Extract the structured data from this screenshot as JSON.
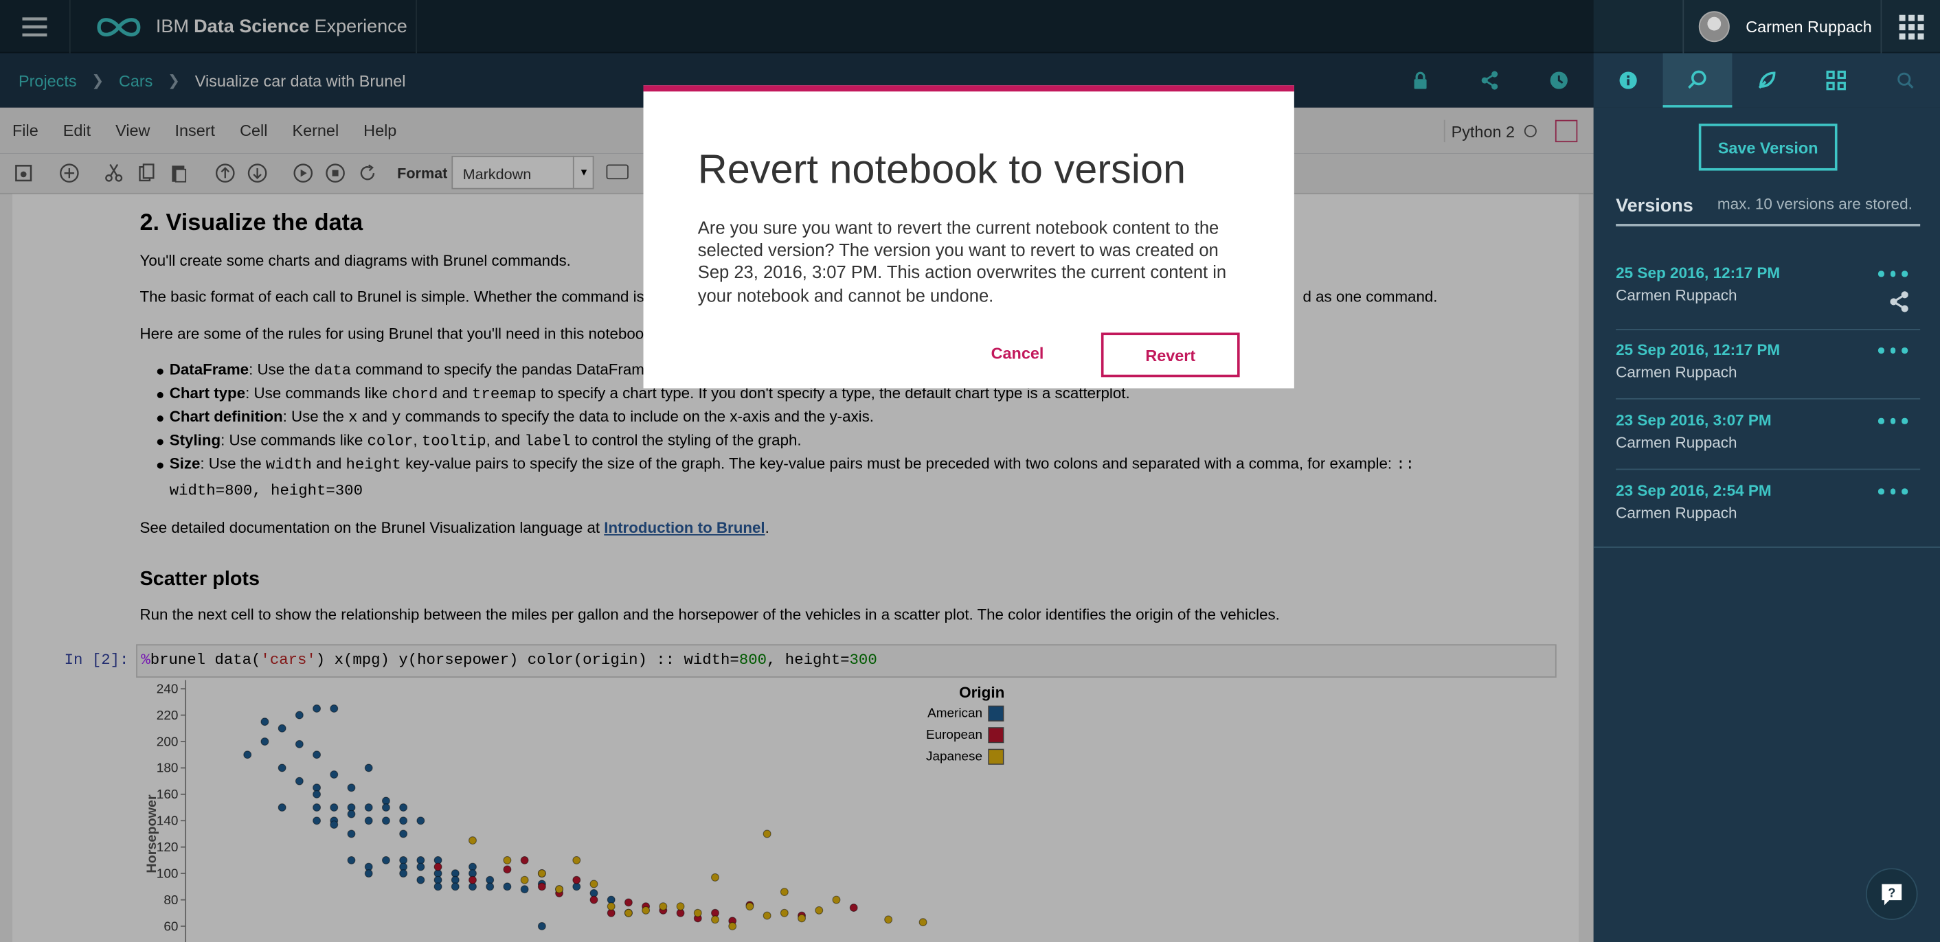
{
  "header": {
    "brand_prefix": "IBM",
    "brand_bold": "Data Science",
    "brand_suffix": "Experience",
    "user_name": "Carmen Ruppach"
  },
  "breadcrumb": [
    "Projects",
    "Cars",
    "Visualize car data with Brunel"
  ],
  "menu": [
    "File",
    "Edit",
    "View",
    "Insert",
    "Cell",
    "Kernel",
    "Help"
  ],
  "kernel": "Python 2",
  "toolbar": {
    "format_label": "Format",
    "format_value": "Markdown"
  },
  "notebook": {
    "h2": "2. Visualize the data",
    "p1": "You'll create some charts and diagrams with Brunel commands.",
    "p2a": "The basic format of each call to Brunel is simple. Whether the command is",
    "p2b": "d as one command.",
    "p3": "Here are some of the rules for using Brunel that you'll need in this noteboo",
    "bullets": [
      {
        "term": "DataFrame",
        "t1": ": Use the ",
        "c1": "data",
        "t2": " command to specify the pandas DataFram"
      },
      {
        "term": "Chart type",
        "t1": ": Use commands like ",
        "c1": "chord",
        "t2": " and ",
        "c2": "treemap",
        "t3": " to specify a chart type. If you don't specify a type, the default chart type is a scatterplot."
      },
      {
        "term": "Chart definition",
        "t1": ": Use the ",
        "c1": "x",
        "t2": " and ",
        "c2": "y",
        "t3": " commands to specify the data to include on the x-axis and the y-axis."
      },
      {
        "term": "Styling",
        "t1": ": Use commands like ",
        "c1": "color",
        "t2": ", ",
        "c2": "tooltip",
        "t3": ", and ",
        "c3": "label",
        "t4": " to control the styling of the graph."
      },
      {
        "term": "Size",
        "t1": ": Use the ",
        "c1": "width",
        "t2": " and ",
        "c2": "height",
        "t3": " key-value pairs to specify the size of the graph. The key-value pairs must be preceded with two colons and separated with a comma, for example: ",
        "c3": "::",
        "line2": "width=800, height=300"
      }
    ],
    "p4a": "See detailed documentation on the Brunel Visualization language at ",
    "p4link": "Introduction to Brunel",
    "p4b": ".",
    "h3": "Scatter plots",
    "p5": "Run the next cell to show the relationship between the miles per gallon and the horsepower of the vehicles in a scatter plot. The color identifies the origin of the vehicles.",
    "prompt": "In [2]:",
    "code": {
      "pct": "%",
      "a": "brunel data(",
      "s": "'cars'",
      "b": ") x(mpg) y(horsepower) color(origin) :: width=",
      "n1": "800",
      "c": ", height=",
      "n2": "300"
    }
  },
  "chart_data": {
    "type": "scatter",
    "ylabel": "Horsepower",
    "yticks": [
      60,
      80,
      100,
      120,
      140,
      160,
      180,
      200,
      220,
      240
    ],
    "legend_title": "Origin",
    "legend_position": "top-right",
    "series": [
      {
        "name": "American",
        "color": "#1f5f95",
        "points": [
          [
            9,
            190
          ],
          [
            10,
            215
          ],
          [
            10,
            200
          ],
          [
            11,
            210
          ],
          [
            11,
            180
          ],
          [
            11,
            150
          ],
          [
            12,
            220
          ],
          [
            12,
            198
          ],
          [
            12,
            170
          ],
          [
            13,
            225
          ],
          [
            13,
            190
          ],
          [
            13,
            165
          ],
          [
            13,
            160
          ],
          [
            13,
            150
          ],
          [
            13,
            140
          ],
          [
            14,
            225
          ],
          [
            14,
            175
          ],
          [
            14,
            150
          ],
          [
            14,
            140
          ],
          [
            14,
            137
          ],
          [
            15,
            165
          ],
          [
            15,
            150
          ],
          [
            15,
            145
          ],
          [
            15,
            130
          ],
          [
            15,
            110
          ],
          [
            16,
            180
          ],
          [
            16,
            150
          ],
          [
            16,
            140
          ],
          [
            16,
            105
          ],
          [
            16,
            100
          ],
          [
            17,
            155
          ],
          [
            17,
            150
          ],
          [
            17,
            140
          ],
          [
            17,
            110
          ],
          [
            18,
            150
          ],
          [
            18,
            140
          ],
          [
            18,
            130
          ],
          [
            18,
            110
          ],
          [
            18,
            105
          ],
          [
            18,
            100
          ],
          [
            19,
            140
          ],
          [
            19,
            110
          ],
          [
            19,
            105
          ],
          [
            19,
            95
          ],
          [
            20,
            110
          ],
          [
            20,
            100
          ],
          [
            20,
            95
          ],
          [
            20,
            90
          ],
          [
            21,
            100
          ],
          [
            21,
            95
          ],
          [
            21,
            90
          ],
          [
            22,
            105
          ],
          [
            22,
            100
          ],
          [
            22,
            90
          ],
          [
            23,
            95
          ],
          [
            23,
            90
          ],
          [
            24,
            90
          ],
          [
            25,
            88
          ],
          [
            26,
            92
          ],
          [
            27,
            88
          ],
          [
            28,
            90
          ],
          [
            29,
            85
          ],
          [
            30,
            80
          ],
          [
            31,
            70
          ],
          [
            26,
            60
          ]
        ]
      },
      {
        "name": "European",
        "color": "#c0152f",
        "points": [
          [
            20,
            105
          ],
          [
            22,
            95
          ],
          [
            24,
            103
          ],
          [
            25,
            110
          ],
          [
            26,
            100
          ],
          [
            26,
            90
          ],
          [
            27,
            85
          ],
          [
            28,
            95
          ],
          [
            29,
            80
          ],
          [
            30,
            70
          ],
          [
            31,
            78
          ],
          [
            32,
            75
          ],
          [
            33,
            72
          ],
          [
            34,
            70
          ],
          [
            35,
            66
          ],
          [
            36,
            70
          ],
          [
            37,
            64
          ],
          [
            38,
            76
          ],
          [
            41,
            68
          ],
          [
            44,
            74
          ]
        ]
      },
      {
        "name": "Japanese",
        "color": "#e5b70e",
        "points": [
          [
            22,
            125
          ],
          [
            24,
            110
          ],
          [
            25,
            95
          ],
          [
            26,
            100
          ],
          [
            27,
            88
          ],
          [
            28,
            110
          ],
          [
            29,
            92
          ],
          [
            30,
            75
          ],
          [
            31,
            70
          ],
          [
            32,
            72
          ],
          [
            33,
            75
          ],
          [
            34,
            75
          ],
          [
            35,
            70
          ],
          [
            36,
            65
          ],
          [
            37,
            60
          ],
          [
            38,
            75
          ],
          [
            39,
            68
          ],
          [
            40,
            70
          ],
          [
            41,
            66
          ],
          [
            42,
            72
          ],
          [
            43,
            80
          ],
          [
            46,
            65
          ],
          [
            48,
            63
          ],
          [
            39,
            130
          ],
          [
            36,
            97
          ],
          [
            40,
            86
          ]
        ]
      }
    ]
  },
  "modal": {
    "title": "Revert notebook to version",
    "body": "Are you sure you want to revert the current notebook content to the selected version? The version you want to revert to was created on Sep 23, 2016, 3:07 PM. This action overwrites the current content in your notebook and cannot be undone.",
    "cancel": "Cancel",
    "revert": "Revert"
  },
  "panel": {
    "save_version": "Save Version",
    "versions_title": "Versions",
    "versions_note": "max. 10 versions are stored.",
    "versions": [
      {
        "date": "25 Sep 2016, 12:17 PM",
        "user": "Carmen Ruppach"
      },
      {
        "date": "25 Sep 2016, 12:17 PM",
        "user": "Carmen Ruppach"
      },
      {
        "date": "23 Sep 2016, 3:07 PM",
        "user": "Carmen Ruppach"
      },
      {
        "date": "23 Sep 2016, 2:54 PM",
        "user": "Carmen Ruppach"
      }
    ]
  },
  "colors": {
    "accent_teal": "#3ec6c6",
    "accent_magenta": "#c2185b",
    "header_bg": "#152935"
  }
}
